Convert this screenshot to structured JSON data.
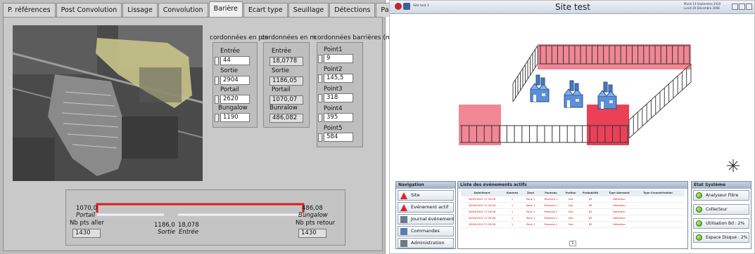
{
  "left_app": {
    "tabs": [
      "P. références",
      "Post Convolution",
      "Lissage",
      "Convolution",
      "Barière",
      "Ecart type",
      "Seuillage",
      "Détections",
      "Paramètres_sauv."
    ],
    "active_tab": "Barière",
    "col_heads": {
      "pts": "cordonnées en pts",
      "m": "cordonnées en m",
      "barrieres": "cordonnées barrières (m)"
    },
    "pts": {
      "entree_label": "Entrée",
      "entree": "44",
      "sortie_label": "Sortie",
      "sortie": "2904",
      "portail_label": "Portail",
      "portail": "2620",
      "bungalow_label": "Bungalow",
      "bungalow": "1190"
    },
    "m": {
      "entree_label": "Entrée",
      "entree": "18,0778",
      "sortie_label": "Sortie",
      "sortie": "1186,05",
      "portail_label": "Portail",
      "portail": "1070,07",
      "bungalow_label": "Bunralow",
      "bungalow": "486,082"
    },
    "barrieres": [
      {
        "label": "Point1",
        "value": "9"
      },
      {
        "label": "Point2",
        "value": "145,5"
      },
      {
        "label": "Point3",
        "value": "318"
      },
      {
        "label": "Point4",
        "value": "395"
      },
      {
        "label": "Point5",
        "value": "584"
      }
    ],
    "bottom": {
      "left_value": "1070,0",
      "left_caption": "Portail",
      "right_value": "486,08",
      "right_caption": "Bungalow",
      "mid_left_value": "1186,0",
      "mid_left_caption": "Sortie",
      "mid_right_value": "18,078",
      "mid_right_caption": "Entrée",
      "nb_aller_label": "Nb pts aller",
      "nb_aller": "1430",
      "nb_retour_label": "Nb pts retour",
      "nb_retour": "1430"
    }
  },
  "right_app": {
    "title": "Site test",
    "top_left_text": "Site test  1",
    "top_right_text_1": "Mardi 14 Septembre 2010",
    "top_right_text_2": "Lundi 30 Décembre 2008",
    "nav": {
      "header": "Navigation",
      "items": [
        "Site",
        "Evénement actif",
        "Journal événement",
        "Commandes",
        "Administration"
      ]
    },
    "events": {
      "header": "Liste des événements actifs",
      "columns": [
        "Date/Heure",
        "Alarmes",
        "Zone",
        "Panneau",
        "Portion",
        "Probabilité",
        "Type Alerment",
        "Type Caractérisation"
      ],
      "rows": [
        [
          "28/09/2010 17:33:06",
          "1",
          "Zone 1",
          "Panneau 1",
          "Sud",
          "83",
          "Détection",
          ""
        ],
        [
          "28/09/2010 17:33:06",
          "1",
          "Zone 1",
          "Panneau 1",
          "Sud",
          "83",
          "Détection",
          ""
        ],
        [
          "28/09/2010 17:33:06",
          "1",
          "Zone 1",
          "Panneau 1",
          "Sud",
          "83",
          "Détection",
          ""
        ],
        [
          "28/09/2010 17:33:06",
          "1",
          "Zone 1",
          "Panneau 1",
          "Sud",
          "83",
          "Détection",
          ""
        ],
        [
          "28/09/2010 17:33:06",
          "1",
          "Zone 1",
          "Panneau 1",
          "Sud",
          "83",
          "Détection",
          ""
        ]
      ],
      "pager": "1"
    },
    "status": {
      "header": "Etat Système",
      "items": [
        "Analyseur Fibre",
        "Collecteur",
        "Utilisation Bd : 2%",
        "Espace Disque : 2%"
      ]
    },
    "colors": {
      "alert_red": "#e8203a",
      "zone_pink": "#f07a8a",
      "ok_green": "#5fbf22"
    }
  }
}
